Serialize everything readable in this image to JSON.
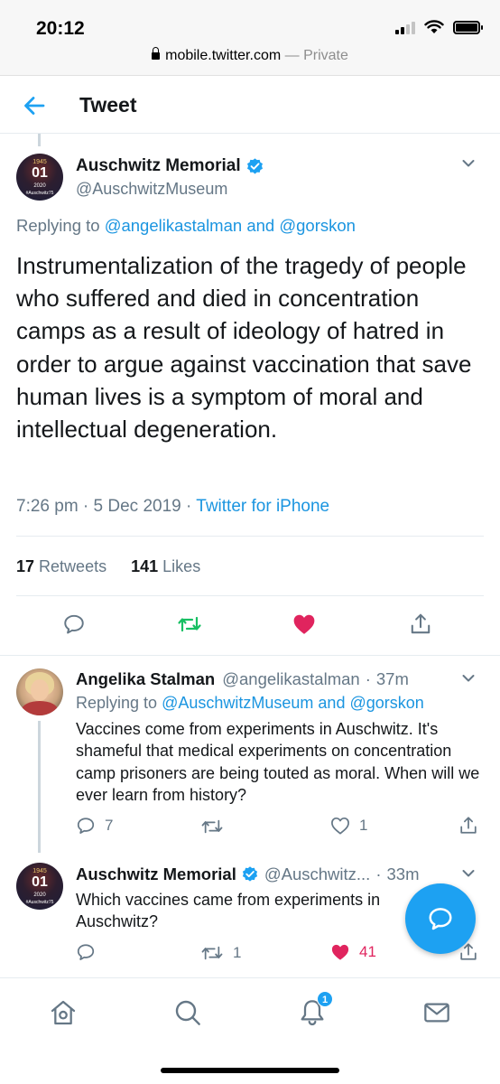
{
  "status_bar": {
    "time": "20:12",
    "url": "mobile.twitter.com",
    "private_label": "— Private"
  },
  "header": {
    "title": "Tweet"
  },
  "main_tweet": {
    "author_name": "Auschwitz Memorial",
    "author_handle": "@AuschwitzMuseum",
    "replying_prefix": "Replying to",
    "replying_user1": "@angelikastalman",
    "replying_and": "and",
    "replying_user2": "@gorskon",
    "text": "Instrumentalization of the tragedy of people who suffered and died in concentration camps as a result of ideology of hatred in order to argue against vaccination that save human lives is a symptom of moral and intellectual degeneration.",
    "time": "7:26 pm",
    "date": "5 Dec 2019",
    "source": "Twitter for iPhone",
    "retweet_count": "17",
    "retweet_label": "Retweets",
    "like_count": "141",
    "like_label": "Likes",
    "liked": true
  },
  "replies": [
    {
      "author_name": "Angelika Stalman",
      "author_handle": "@angelikastalman",
      "time_ago": "37m",
      "replying_prefix": "Replying to",
      "replying_user1": "@AuschwitzMuseum",
      "replying_and": "and",
      "replying_user2": "@gorskon",
      "text": "Vaccines come from experiments in Auschwitz. It's shameful that medical experiments on concentration camp prisoners are being touted as moral. When will we ever learn from history?",
      "reply_count": "7",
      "retweet_count": "",
      "like_count": "1"
    },
    {
      "author_name": "Auschwitz Memorial",
      "author_handle": "@Auschwitz...",
      "time_ago": "33m",
      "text": "Which vaccines came from experiments in Auschwitz?",
      "reply_count": "",
      "retweet_count": "1",
      "like_count": "41",
      "liked": true
    }
  ],
  "avatar_text": {
    "line1": "1945",
    "line2": "01",
    "line3": "2020",
    "line4": "#Auschwitz75"
  },
  "notifications_badge": "1",
  "icons": [
    "back-arrow-icon",
    "verified-badge-icon",
    "chevron-down-icon",
    "reply-icon",
    "retweet-icon",
    "like-icon",
    "share-icon",
    "compose-reply-icon",
    "home-icon",
    "search-icon",
    "notifications-icon",
    "messages-icon"
  ],
  "colors": {
    "brand_blue": "#1da1f2",
    "link_blue": "#1b95e0",
    "like_red": "#e0245e",
    "retweet_green": "#17bf63",
    "secondary_text": "#657786"
  }
}
